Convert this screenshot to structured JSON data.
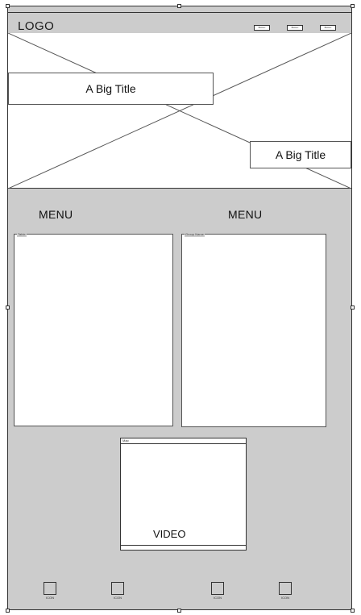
{
  "header": {
    "logo": "LOGO",
    "buttons": [
      "Button",
      "Button",
      "Button"
    ]
  },
  "hero": {
    "title_left": "A Big Title",
    "title_right": "A Big Title"
  },
  "menus": [
    {
      "label": "MENU",
      "panel_caption": "Table"
    },
    {
      "label": "MENU",
      "panel_caption": "Group Name"
    }
  ],
  "media": {
    "caption": "Map",
    "label": "VIDEO"
  },
  "footer_icons": [
    {
      "label": "ICON",
      "icon": "square-icon"
    },
    {
      "label": "ICON",
      "icon": "square-icon"
    },
    {
      "label": "ICON",
      "icon": "square-icon"
    },
    {
      "label": "ICON",
      "icon": "square-icon"
    }
  ]
}
